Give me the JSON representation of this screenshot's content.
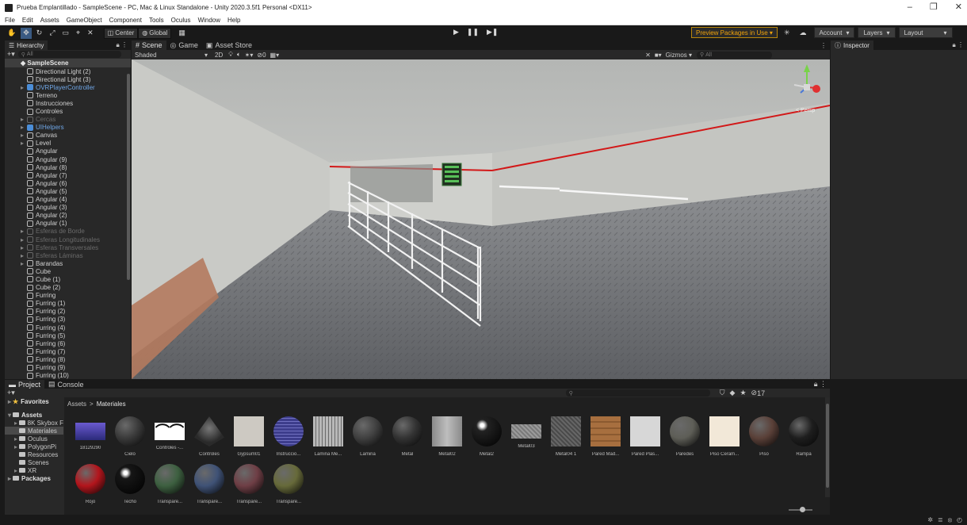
{
  "window": {
    "title": "Prueba Emplantillado - SampleScene - PC, Mac & Linux Standalone - Unity 2020.3.5f1 Personal <DX11>",
    "controls": [
      "–",
      "❐",
      "✕"
    ]
  },
  "menu": [
    "File",
    "Edit",
    "Assets",
    "GameObject",
    "Component",
    "Tools",
    "Oculus",
    "Window",
    "Help"
  ],
  "toolbar": {
    "tools": [
      "hand-tool",
      "move-tool",
      "rotate-tool",
      "scale-tool",
      "rect-tool",
      "transform-tool",
      "custom-tool"
    ],
    "pivot_label": "Center",
    "space_label": "Global",
    "snap_icon": "grid-snap-icon",
    "play_controls": [
      "▶",
      "❚❚",
      "▶❚"
    ],
    "preview_packages": "Preview Packages in Use ▾",
    "account": "Account",
    "layers": "Layers",
    "layout": "Layout"
  },
  "hierarchy": {
    "tab": "Hierarchy",
    "search_placeholder": "All",
    "scene_name": "SampleScene",
    "items": [
      {
        "label": "Directional Light (2)",
        "indent": 2,
        "style": "normal",
        "arrow": ""
      },
      {
        "label": "Directional Light (3)",
        "indent": 2,
        "style": "normal",
        "arrow": ""
      },
      {
        "label": "OVRPlayerController",
        "indent": 2,
        "style": "blue",
        "arrow": "▸"
      },
      {
        "label": "Terreno",
        "indent": 2,
        "style": "normal",
        "arrow": ""
      },
      {
        "label": "Instrucciones",
        "indent": 2,
        "style": "normal",
        "arrow": ""
      },
      {
        "label": "Controles",
        "indent": 2,
        "style": "normal",
        "arrow": ""
      },
      {
        "label": "Cercas",
        "indent": 2,
        "style": "dim",
        "arrow": "▸"
      },
      {
        "label": "UIHelpers",
        "indent": 2,
        "style": "blue",
        "arrow": "▸"
      },
      {
        "label": "Canvas",
        "indent": 2,
        "style": "normal",
        "arrow": "▸"
      },
      {
        "label": "Level",
        "indent": 2,
        "style": "normal",
        "arrow": "▸"
      },
      {
        "label": "Angular",
        "indent": 2,
        "style": "normal",
        "arrow": ""
      },
      {
        "label": "Angular (9)",
        "indent": 2,
        "style": "normal",
        "arrow": ""
      },
      {
        "label": "Angular (8)",
        "indent": 2,
        "style": "normal",
        "arrow": ""
      },
      {
        "label": "Angular (7)",
        "indent": 2,
        "style": "normal",
        "arrow": ""
      },
      {
        "label": "Angular (6)",
        "indent": 2,
        "style": "normal",
        "arrow": ""
      },
      {
        "label": "Angular (5)",
        "indent": 2,
        "style": "normal",
        "arrow": ""
      },
      {
        "label": "Angular (4)",
        "indent": 2,
        "style": "normal",
        "arrow": ""
      },
      {
        "label": "Angular (3)",
        "indent": 2,
        "style": "normal",
        "arrow": ""
      },
      {
        "label": "Angular (2)",
        "indent": 2,
        "style": "normal",
        "arrow": ""
      },
      {
        "label": "Angular (1)",
        "indent": 2,
        "style": "normal",
        "arrow": ""
      },
      {
        "label": "Esferas de Borde",
        "indent": 2,
        "style": "dim",
        "arrow": "▸"
      },
      {
        "label": "Esferas Longitudinales",
        "indent": 2,
        "style": "dim",
        "arrow": "▸"
      },
      {
        "label": "Esferas Transversales",
        "indent": 2,
        "style": "dim",
        "arrow": "▸"
      },
      {
        "label": "Esferas Láminas",
        "indent": 2,
        "style": "dim",
        "arrow": "▸"
      },
      {
        "label": "Barandas",
        "indent": 2,
        "style": "normal",
        "arrow": "▸"
      },
      {
        "label": "Cube",
        "indent": 2,
        "style": "normal",
        "arrow": ""
      },
      {
        "label": "Cube (1)",
        "indent": 2,
        "style": "normal",
        "arrow": ""
      },
      {
        "label": "Cube (2)",
        "indent": 2,
        "style": "normal",
        "arrow": ""
      },
      {
        "label": "Furring",
        "indent": 2,
        "style": "normal",
        "arrow": ""
      },
      {
        "label": "Furring (1)",
        "indent": 2,
        "style": "normal",
        "arrow": ""
      },
      {
        "label": "Furring (2)",
        "indent": 2,
        "style": "normal",
        "arrow": ""
      },
      {
        "label": "Furring (3)",
        "indent": 2,
        "style": "normal",
        "arrow": ""
      },
      {
        "label": "Furring (4)",
        "indent": 2,
        "style": "normal",
        "arrow": ""
      },
      {
        "label": "Furring (5)",
        "indent": 2,
        "style": "normal",
        "arrow": ""
      },
      {
        "label": "Furring (6)",
        "indent": 2,
        "style": "normal",
        "arrow": ""
      },
      {
        "label": "Furring (7)",
        "indent": 2,
        "style": "normal",
        "arrow": ""
      },
      {
        "label": "Furring (8)",
        "indent": 2,
        "style": "normal",
        "arrow": ""
      },
      {
        "label": "Furring (9)",
        "indent": 2,
        "style": "normal",
        "arrow": ""
      },
      {
        "label": "Furring (10)",
        "indent": 2,
        "style": "normal",
        "arrow": ""
      }
    ]
  },
  "scene": {
    "tabs": [
      {
        "label": "Scene",
        "icon": "#",
        "active": true
      },
      {
        "label": "Game",
        "icon": "◎",
        "active": false
      },
      {
        "label": "Asset Store",
        "icon": "▣",
        "active": false
      }
    ],
    "shading_mode": "Shaded",
    "mode_2d": "2D",
    "gizmos": "Gizmos",
    "search_placeholder": "All",
    "gizmo_axis_label": "< Persp"
  },
  "inspector": {
    "tab": "Inspector"
  },
  "project": {
    "tabs": [
      {
        "label": "Project",
        "active": true
      },
      {
        "label": "Console",
        "active": false
      }
    ],
    "visible_count": "17",
    "breadcrumb": [
      "Assets",
      "Materiales"
    ],
    "tree": [
      {
        "label": "Favorites",
        "style": "bold",
        "arrow": "▸",
        "indent": 0
      },
      {
        "label": "Assets",
        "style": "bold",
        "arrow": "▾",
        "indent": 0
      },
      {
        "label": "8K Skybox F",
        "style": "normal",
        "arrow": "▸",
        "indent": 1
      },
      {
        "label": "Materiales",
        "style": "sel",
        "arrow": "",
        "indent": 1
      },
      {
        "label": "Oculus",
        "style": "normal",
        "arrow": "▸",
        "indent": 1
      },
      {
        "label": "PolygonPi",
        "style": "normal",
        "arrow": "▸",
        "indent": 1
      },
      {
        "label": "Resources",
        "style": "normal",
        "arrow": "",
        "indent": 1
      },
      {
        "label": "Scenes",
        "style": "normal",
        "arrow": "",
        "indent": 1
      },
      {
        "label": "XR",
        "style": "normal",
        "arrow": "▸",
        "indent": 1
      },
      {
        "label": "Packages",
        "style": "bold",
        "arrow": "▸",
        "indent": 0
      }
    ],
    "assets": [
      {
        "label": "18129290",
        "kind": "image",
        "color": "#2b2a7a"
      },
      {
        "label": "Cielo",
        "kind": "ball",
        "color": "#3a3a3a"
      },
      {
        "label": "Controles -...",
        "kind": "image-white",
        "color": "#ffffff"
      },
      {
        "label": "Controles",
        "kind": "cone",
        "color": "#2a2a2a"
      },
      {
        "label": "Gypsum01",
        "kind": "square",
        "color": "#cdc9c2"
      },
      {
        "label": "Instruccio...",
        "kind": "ball-striped",
        "color": "#3d3d8c"
      },
      {
        "label": "Lamina Me...",
        "kind": "stripes",
        "color": "#b8b8b8"
      },
      {
        "label": "Lamina",
        "kind": "ball",
        "color": "#404040"
      },
      {
        "label": "Metal",
        "kind": "ball",
        "color": "#333333"
      },
      {
        "label": "Metal02",
        "kind": "square-metal",
        "color": "#bdbdbd"
      },
      {
        "label": "Metal2",
        "kind": "ball-shiny",
        "color": "#222222"
      },
      {
        "label": "Metal03",
        "kind": "plate",
        "color": "#9a9a9a"
      },
      {
        "label": "Metal04 1",
        "kind": "square-dark",
        "color": "#666666"
      },
      {
        "label": "Pared Mad...",
        "kind": "wood",
        "color": "#a76f3f"
      },
      {
        "label": "Pared Plas...",
        "kind": "square",
        "color": "#d7d7d7"
      },
      {
        "label": "Paredes",
        "kind": "ball",
        "color": "#5e5e57"
      },
      {
        "label": "Piso Ceram...",
        "kind": "square",
        "color": "#f2e8d8"
      },
      {
        "label": "Piso",
        "kind": "ball",
        "color": "#5a4038"
      },
      {
        "label": "Rampa",
        "kind": "ball",
        "color": "#1e1e1e"
      },
      {
        "label": "Rojo",
        "kind": "ball",
        "color": "#b3151c"
      },
      {
        "label": "Techo",
        "kind": "ball-shiny",
        "color": "#161616"
      },
      {
        "label": "Transpare...",
        "kind": "ball",
        "color": "#3d6040"
      },
      {
        "label": "Transpare...",
        "kind": "ball",
        "color": "#3f5276"
      },
      {
        "label": "Transpare...",
        "kind": "ball",
        "color": "#6e3e45"
      },
      {
        "label": "Transpare...",
        "kind": "ball",
        "color": "#676a3a"
      }
    ]
  }
}
